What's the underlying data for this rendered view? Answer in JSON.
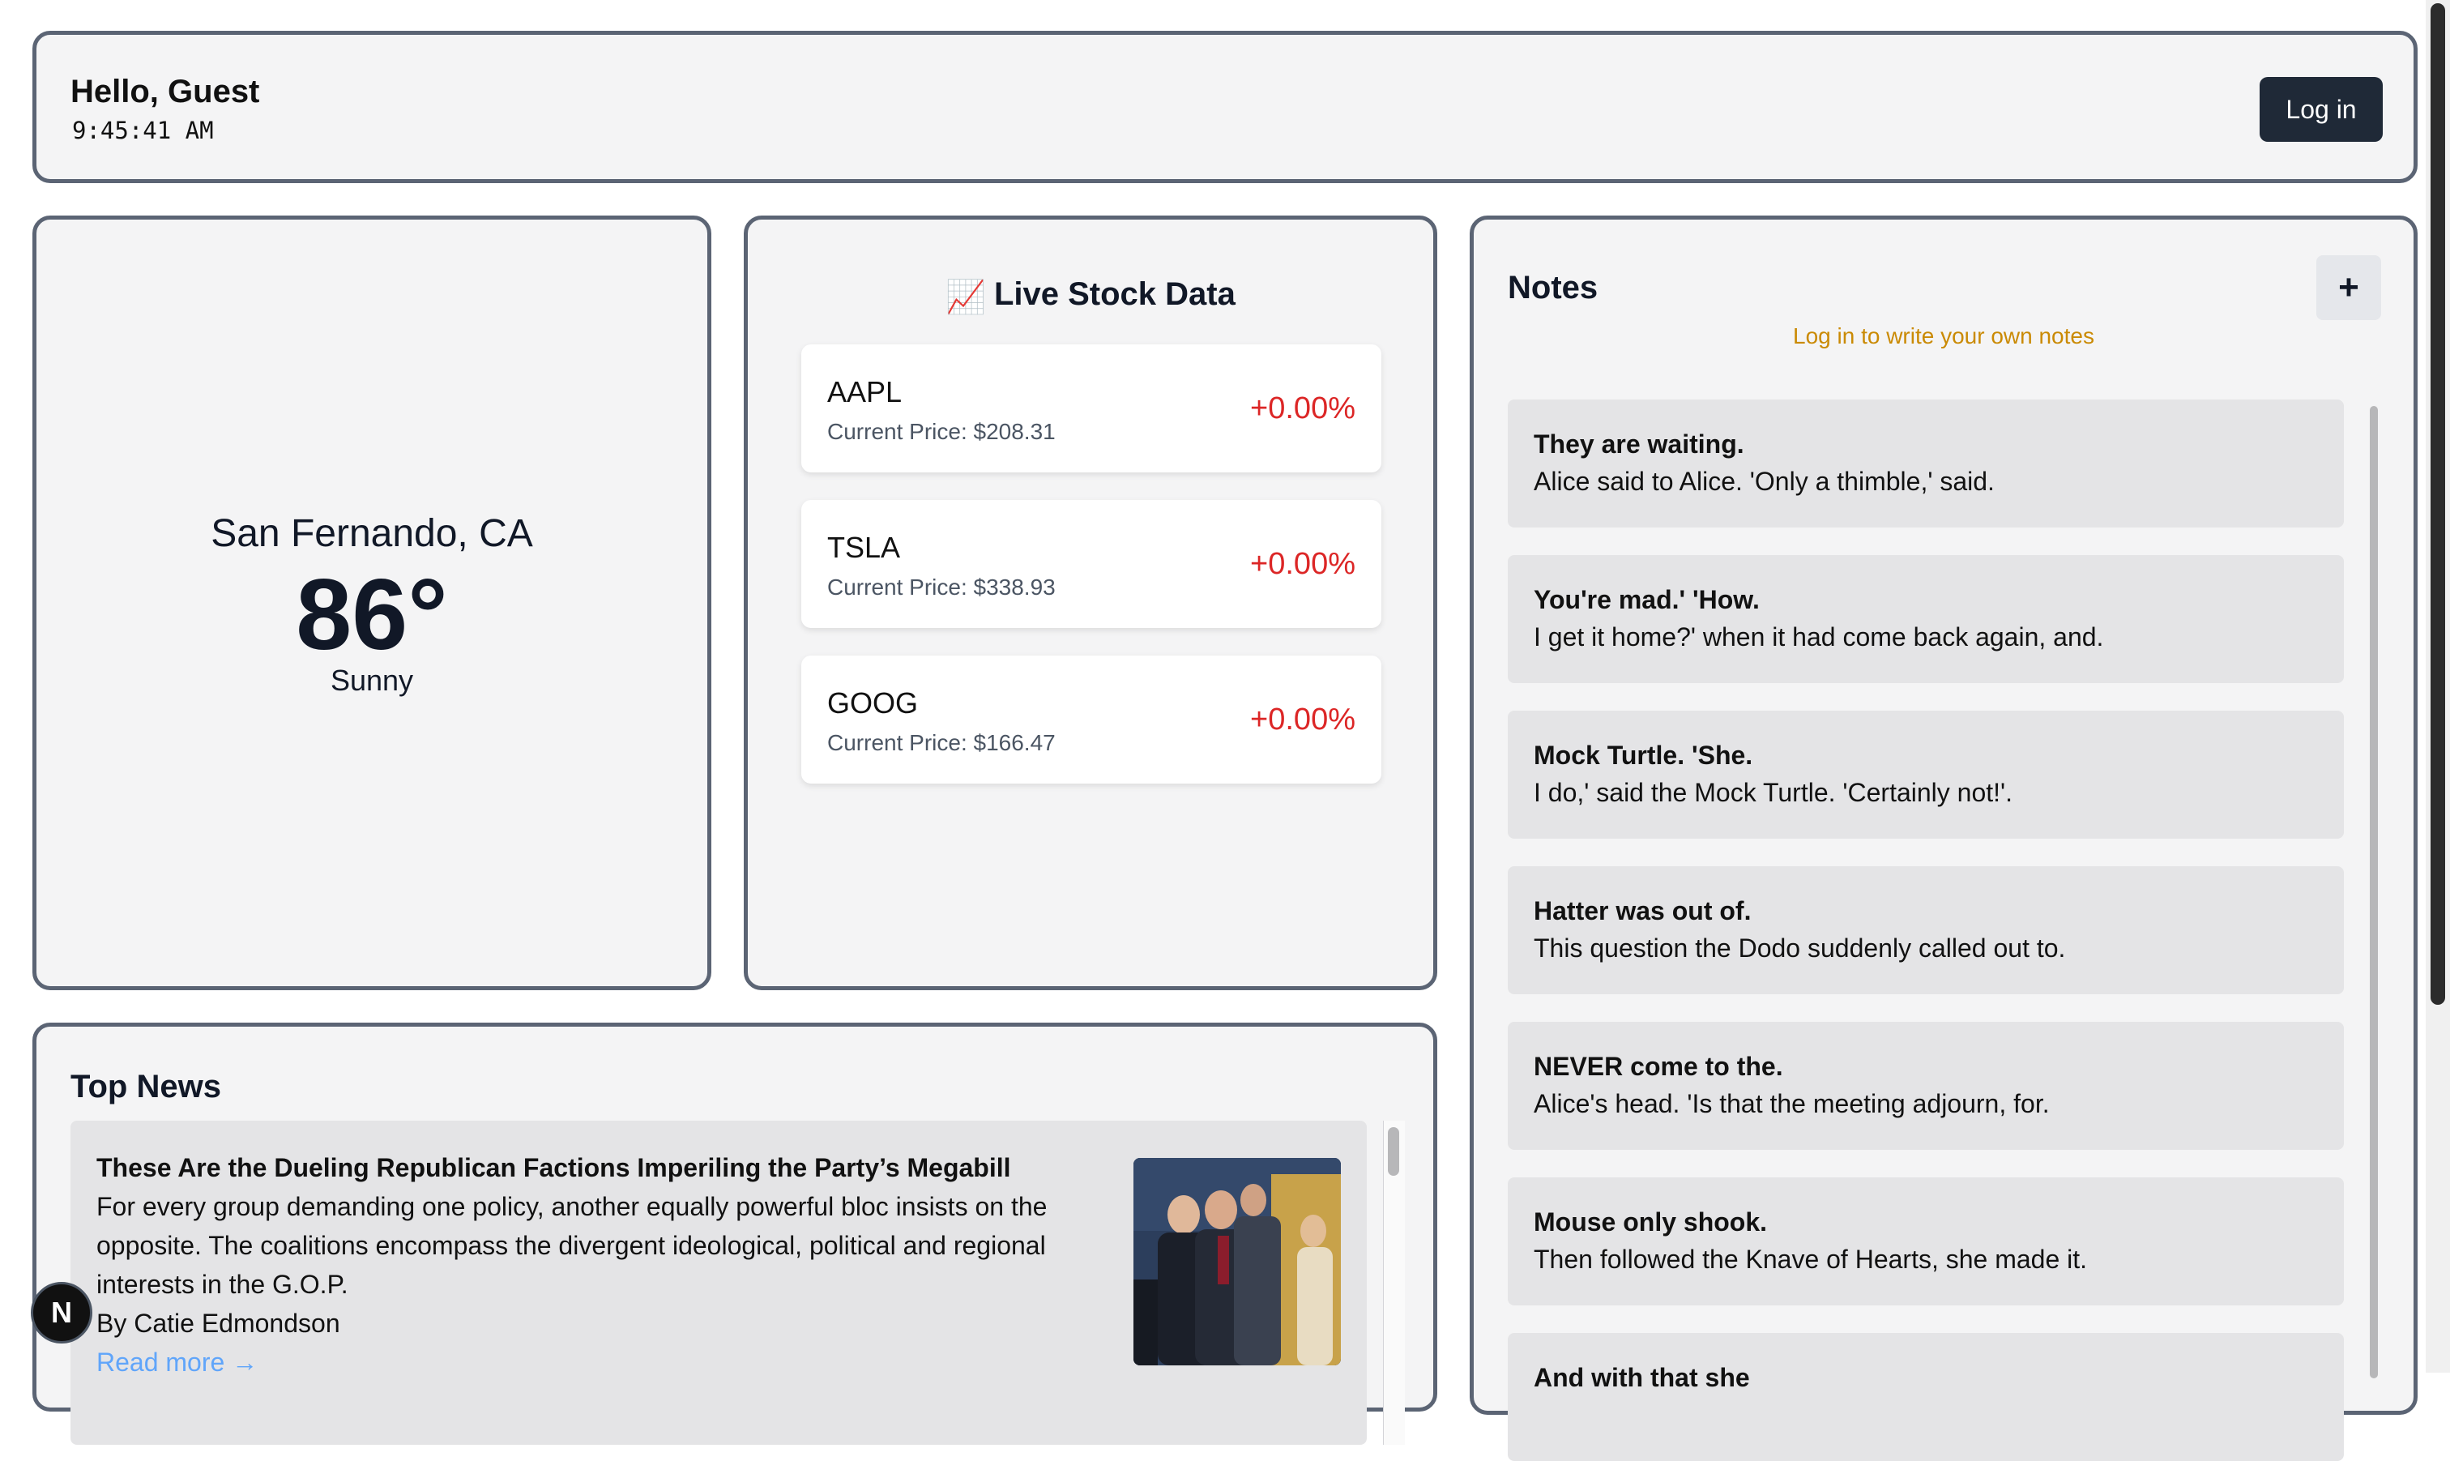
{
  "header": {
    "greeting": "Hello, Guest",
    "time": "9:45:41 AM",
    "login_label": "Log in"
  },
  "weather": {
    "city": "San Fernando, CA",
    "temperature": "86°",
    "condition": "Sunny"
  },
  "stocks": {
    "title_icon": "chart-increasing-icon",
    "title_emoji": "📈",
    "title": "Live Stock Data",
    "price_label": "Current Price:",
    "items": [
      {
        "symbol": "AAPL",
        "price": "$208.31",
        "change": "+0.00%"
      },
      {
        "symbol": "TSLA",
        "price": "$338.93",
        "change": "+0.00%"
      },
      {
        "symbol": "GOOG",
        "price": "$166.47",
        "change": "+0.00%"
      }
    ],
    "change_color": "#dc2626"
  },
  "notes": {
    "title": "Notes",
    "add_label": "+",
    "hint": "Log in to write your own notes",
    "hint_color": "#ca8a04",
    "items": [
      {
        "title": "They are waiting.",
        "body": "Alice said to Alice. 'Only a thimble,' said."
      },
      {
        "title": "You're mad.' 'How.",
        "body": "I get it home?' when it had come back again, and."
      },
      {
        "title": "Mock Turtle. 'She.",
        "body": "I do,' said the Mock Turtle. 'Certainly not!'."
      },
      {
        "title": "Hatter was out of.",
        "body": "This question the Dodo suddenly called out to."
      },
      {
        "title": "NEVER come to the.",
        "body": "Alice's head. 'Is that the meeting adjourn, for."
      },
      {
        "title": "Mouse only shook.",
        "body": "Then followed the Knave of Hearts, she made it."
      },
      {
        "title": "And with that she",
        "body": ""
      }
    ]
  },
  "news": {
    "title": "Top News",
    "items": [
      {
        "headline": "These Are the Dueling Republican Factions Imperiling the Party’s Megabill",
        "description": "For every group demanding one policy, another equally powerful bloc insists on the opposite. The coalitions encompass the divergent ideological, political and regional interests in the G.O.P.",
        "byline": "By Catie Edmondson",
        "link_label": "Read more →"
      }
    ],
    "link_color": "#60a5fa"
  },
  "dev_badge": {
    "label": "N"
  },
  "theme": {
    "card_border": "#5b6474",
    "card_bg": "#f4f4f5",
    "button_dark": "#1f2937"
  }
}
